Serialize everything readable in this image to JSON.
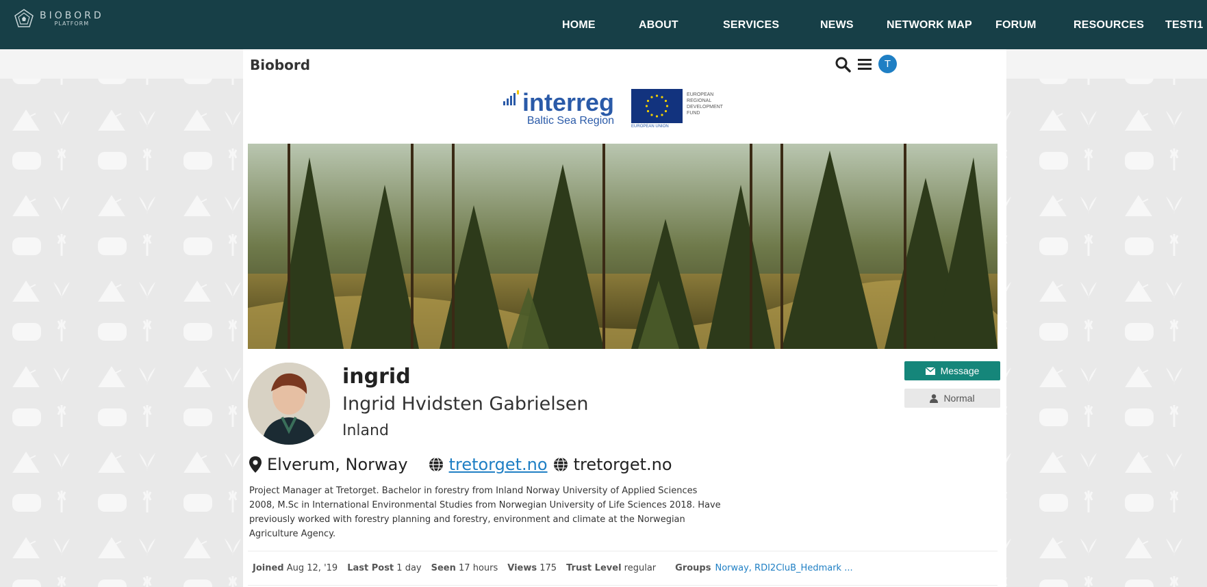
{
  "brand": {
    "line1": "BIOBORD",
    "line2": "PLATFORM"
  },
  "nav": [
    "HOME",
    "ABOUT",
    "SERVICES",
    "NEWS",
    "NETWORK MAP",
    "FORUM",
    "RESOURCES",
    "TESTI1"
  ],
  "header": {
    "title": "Biobord",
    "avatar_letter": "T"
  },
  "sponsor": {
    "interreg": "interreg",
    "interreg_sub": "Baltic Sea Region",
    "eu_text": [
      "EUROPEAN",
      "REGIONAL",
      "DEVELOPMENT",
      "FUND"
    ],
    "eu_under": "EUROPEAN UNION"
  },
  "profile": {
    "username": "ingrid",
    "full_name": "Ingrid Hvidsten Gabrielsen",
    "organization": "Inland",
    "location": "Elverum, Norway",
    "website_link": "tretorget.no",
    "website_text": "tretorget.no",
    "bio": "Project Manager at Tretorget. Bachelor in forestry from Inland Norway University of Applied Sciences 2008, M.Sc in International Environmental Studies from Norwegian University of Life Sciences 2018. Have previously worked with forestry planning and forestry, environment and climate at the Norwegian Agriculture Agency.",
    "message_label": "Message",
    "trust_label": "Normal"
  },
  "stats": {
    "joined_label": "Joined",
    "joined_value": "Aug 12, '19",
    "last_post_label": "Last Post",
    "last_post_value": "1 day",
    "seen_label": "Seen",
    "seen_value": "17 hours",
    "views_label": "Views",
    "views_value": "175",
    "trust_label": "Trust Level",
    "trust_value": "regular",
    "groups_label": "Groups",
    "groups_value": "Norway,  RDI2CluB_Hedmark ..."
  },
  "colors": {
    "nav_bg": "#173f47",
    "accent": "#15867a",
    "link": "#1f7fc4"
  }
}
